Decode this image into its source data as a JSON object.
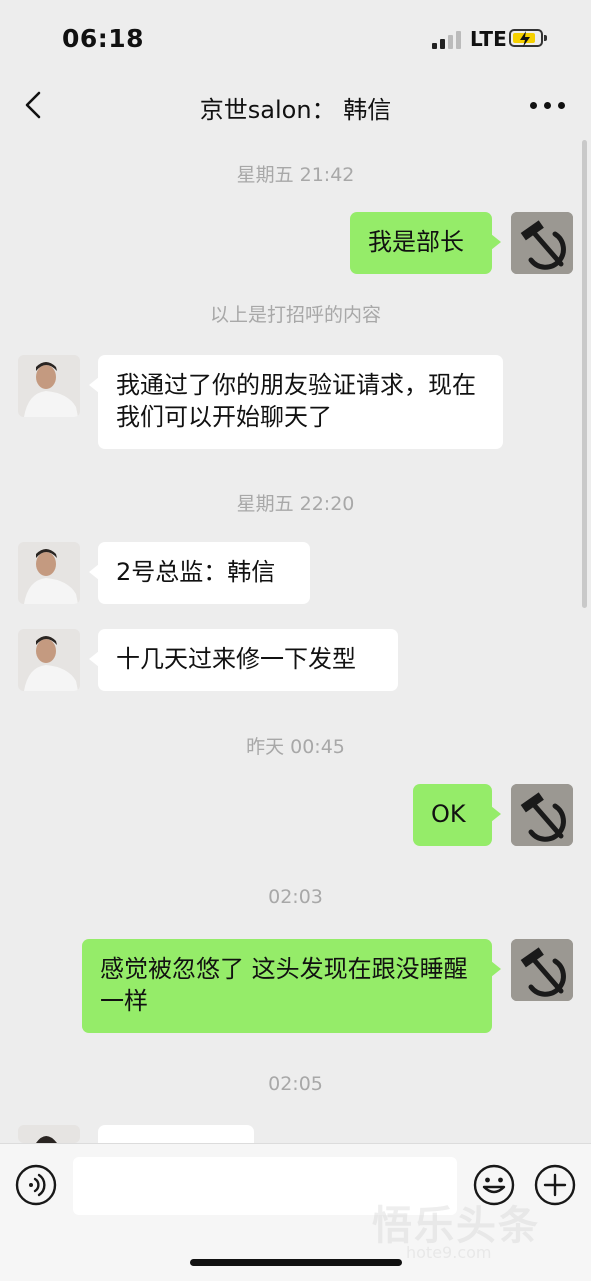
{
  "status_bar": {
    "time": "06:18",
    "network": "LTE"
  },
  "header": {
    "title": "京世salon： 韩信"
  },
  "messages": [
    {
      "type": "timestamp",
      "text": "星期五 21:42"
    },
    {
      "type": "outgoing",
      "text": "我是部长"
    },
    {
      "type": "system",
      "text": "以上是打招呼的内容"
    },
    {
      "type": "incoming",
      "text": "我通过了你的朋友验证请求，现在我们可以开始聊天了"
    },
    {
      "type": "timestamp",
      "text": "星期五 22:20"
    },
    {
      "type": "incoming",
      "text": "2号总监：韩信"
    },
    {
      "type": "incoming",
      "text": "十几天过来修一下发型"
    },
    {
      "type": "timestamp",
      "text": "昨天 00:45"
    },
    {
      "type": "outgoing",
      "text": "OK"
    },
    {
      "type": "timestamp",
      "text": "02:03"
    },
    {
      "type": "outgoing",
      "text": "感觉被忽悠了 这头发现在跟没睡醒一样"
    },
    {
      "type": "timestamp",
      "text": "02:05"
    }
  ],
  "input": {
    "placeholder": ""
  },
  "icons": {
    "back": "chevron-left-icon",
    "more": "more-dots-icon",
    "voice": "voice-icon",
    "emoji": "emoji-icon",
    "plus": "plus-icon"
  },
  "watermark": {
    "text": "悟乐头条",
    "sub": "hote9.com"
  },
  "colors": {
    "background": "#ededed",
    "outgoing_bubble": "#95ec69",
    "incoming_bubble": "#ffffff",
    "timestamp_text": "#a8a8a8",
    "battery_fill": "#f5d000"
  }
}
